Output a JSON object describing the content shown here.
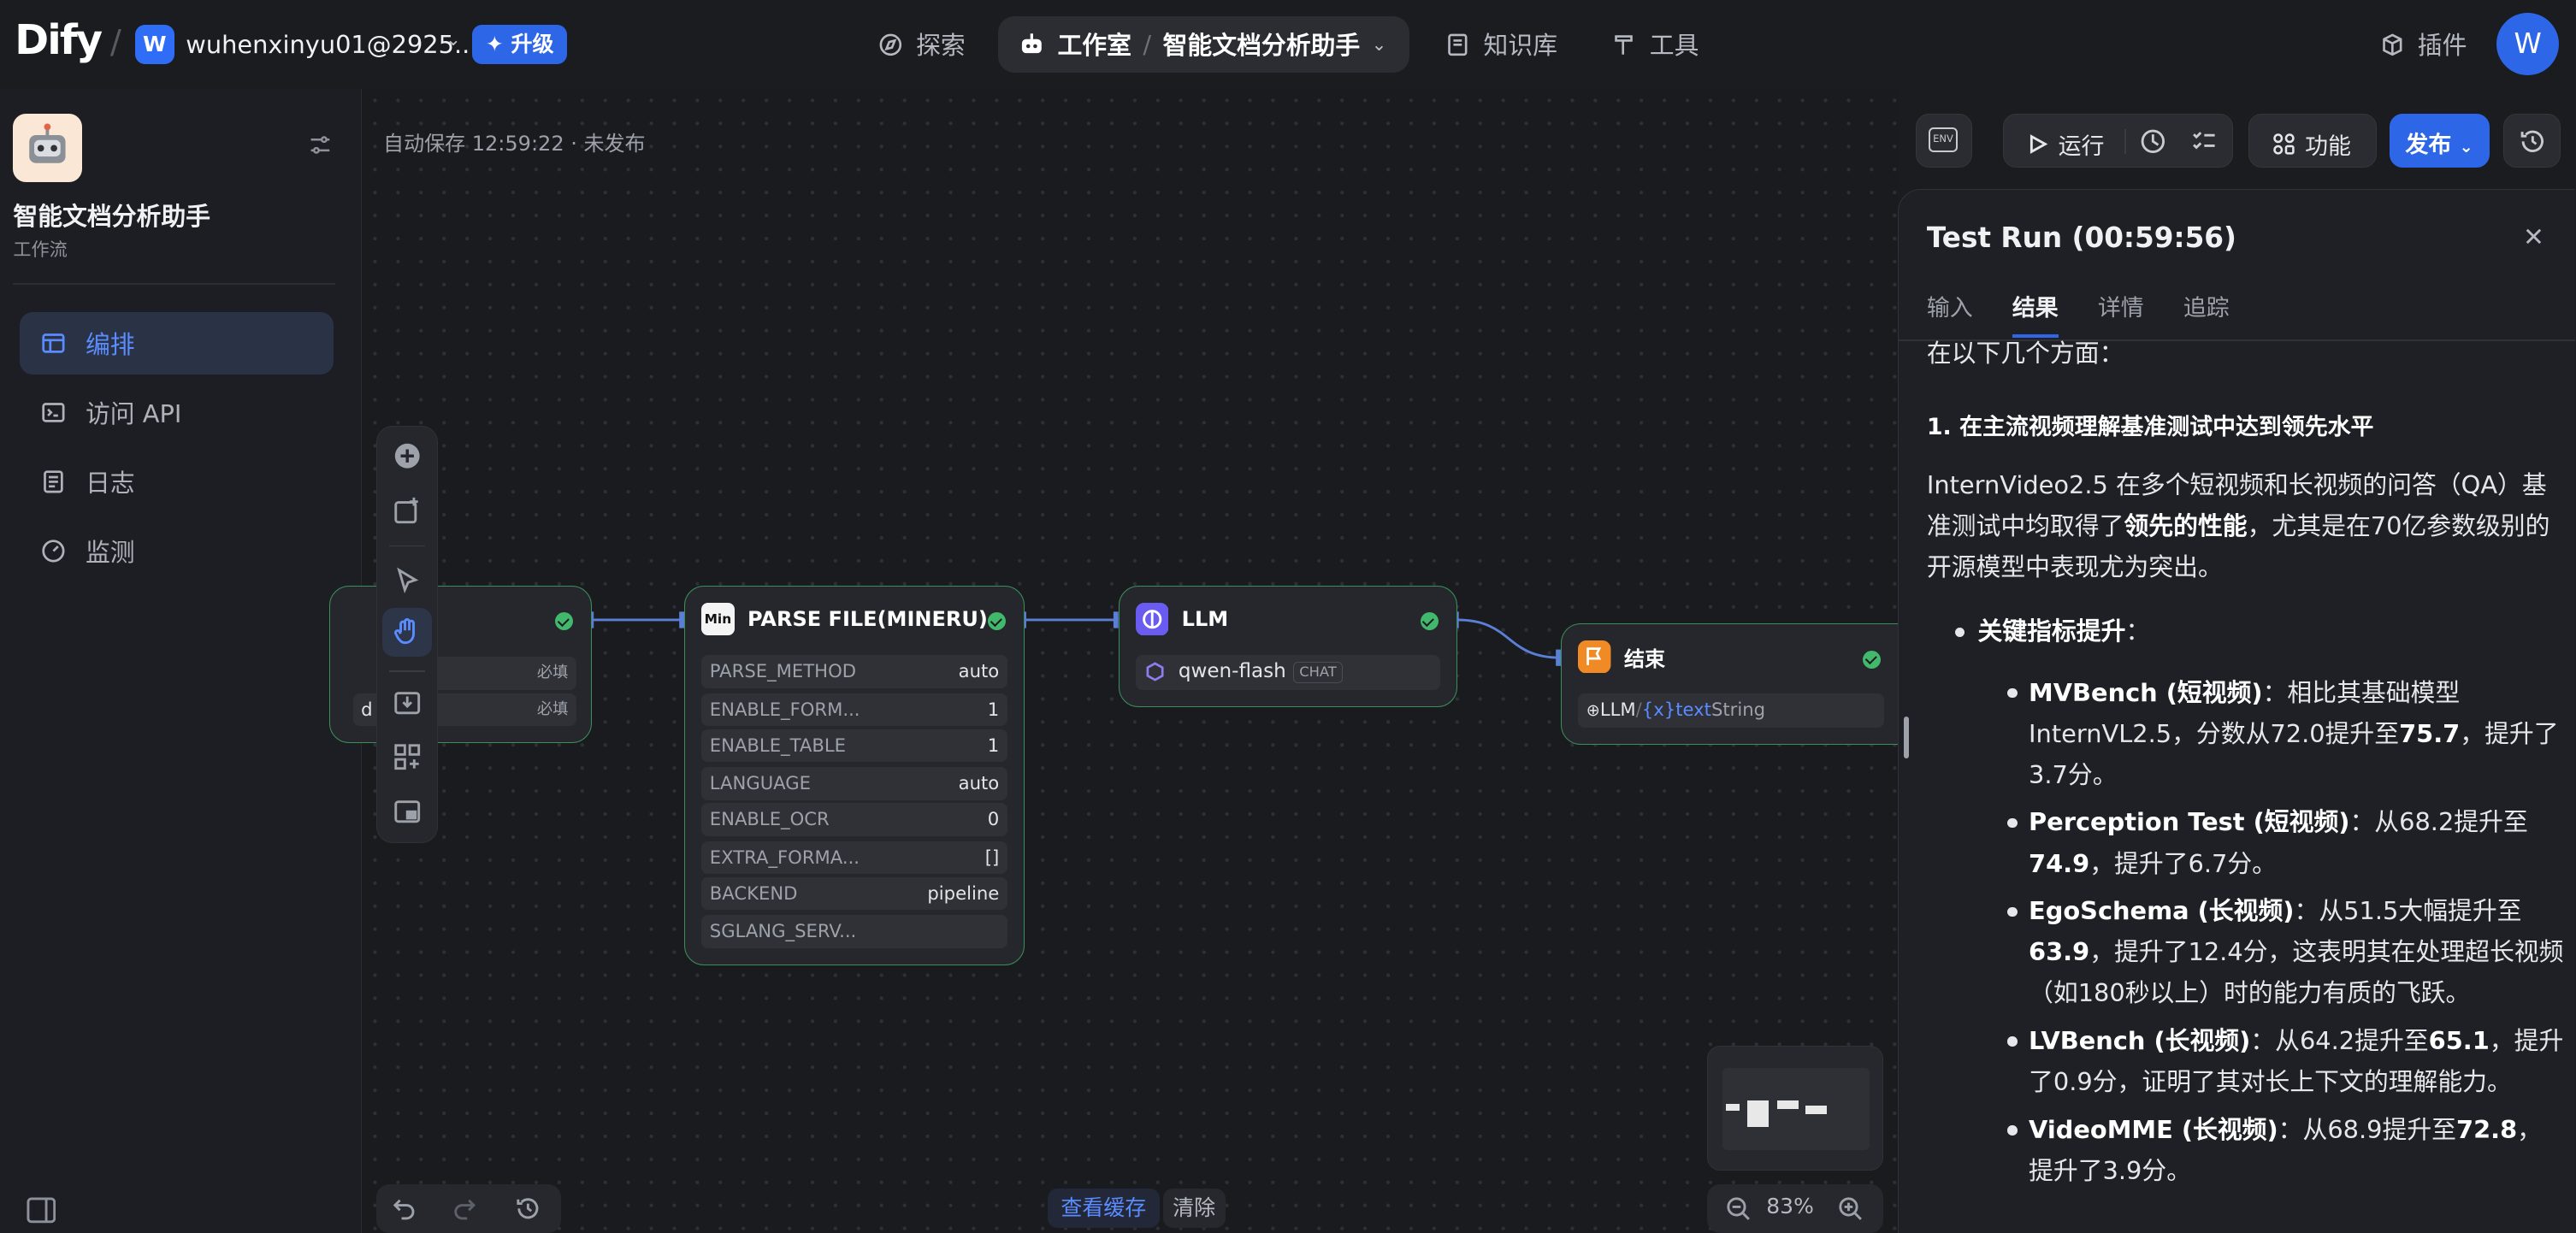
{
  "topbar": {
    "logo": "Dify",
    "workspace_initial": "W",
    "workspace_name": "wuhenxinyu01@2925....",
    "upgrade": "✦ 升级",
    "nav": {
      "explore": "探索",
      "studio": "工作室",
      "app_name": "智能文档分析助手",
      "knowledge": "知识库",
      "tools": "工具",
      "plugins": "插件"
    },
    "user_initial": "W"
  },
  "sidebar": {
    "app_title": "智能文档分析助手",
    "app_type": "工作流",
    "items": [
      {
        "label": "编排"
      },
      {
        "label": "访问 API"
      },
      {
        "label": "日志"
      },
      {
        "label": "监测"
      }
    ]
  },
  "canvas": {
    "autosave": "自动保存 12:59:22 · 未发布",
    "toolbar": {
      "env": "ENV",
      "run": "运行",
      "features": "功能",
      "publish": "发布"
    },
    "start_node": {
      "row1_tag": "必填",
      "row2_prefix": "d",
      "row2_tag": "必填"
    },
    "parse_node": {
      "icon": "Min",
      "title": "PARSE FILE(MINERU)",
      "params": [
        {
          "k": "PARSE_METHOD",
          "v": "auto"
        },
        {
          "k": "ENABLE_FORM...",
          "v": "1"
        },
        {
          "k": "ENABLE_TABLE",
          "v": "1"
        },
        {
          "k": "LANGUAGE",
          "v": "auto"
        },
        {
          "k": "ENABLE_OCR",
          "v": "0"
        },
        {
          "k": "EXTRA_FORMA...",
          "v": "[]"
        },
        {
          "k": "BACKEND",
          "v": "pipeline"
        },
        {
          "k": "SGLANG_SERV...",
          "v": ""
        }
      ]
    },
    "llm_node": {
      "title": "LLM",
      "model": "qwen-flash",
      "model_tag": "CHAT"
    },
    "end_node": {
      "title": "结束",
      "var_source": "LLM",
      "var_name": "text",
      "var_type": "String"
    },
    "bottom": {
      "view_cache": "查看缓存",
      "clear": "清除",
      "zoom": "83%"
    }
  },
  "test_panel": {
    "title": "Test Run (00:59:56)",
    "tabs": [
      "输入",
      "结果",
      "详情",
      "追踪"
    ],
    "active_tab": "结果",
    "content": {
      "intro": "在以下几个方面：",
      "heading": "1. 在主流视频理解基准测试中达到领先水平",
      "para_a": "InternVideo2.5 在多个短视频和长视频的问答（QA）基准测试中均取得了",
      "para_b": "领先的性能",
      "para_c": "，尤其是在70亿参数级别的开源模型中表现尤为突出。",
      "bullet": "关键指标提升",
      "items": [
        {
          "name": "MVBench (短视频)",
          "t1": "：相比其基础模型 InternVL2.5，分数从72.0提升至",
          "v": "75.7",
          "t2": "，提升了3.7分。"
        },
        {
          "name": "Perception Test (短视频)",
          "t1": "：从68.2提升至",
          "v": "74.9",
          "t2": "，提升了6.7分。"
        },
        {
          "name": "EgoSchema (长视频)",
          "t1": "：从51.5大幅提升至",
          "v": "63.9",
          "t2": "，提升了12.4分，这表明其在处理超长视频（如180秒以上）时的能力有质的飞跃。"
        },
        {
          "name": "LVBench (长视频)",
          "t1": "：从64.2提升至",
          "v": "65.1",
          "t2": "，提升了0.9分，证明了其对长上下文的理解能力。"
        },
        {
          "name": "VideoMME (长视频)",
          "t1": "：从68.9提升至",
          "v": "72.8",
          "t2": "，提升了3.9分。"
        }
      ]
    }
  },
  "colors": {
    "accent": "#2e66e8",
    "node_border": "#3a8f5a",
    "success": "#41b86b"
  }
}
